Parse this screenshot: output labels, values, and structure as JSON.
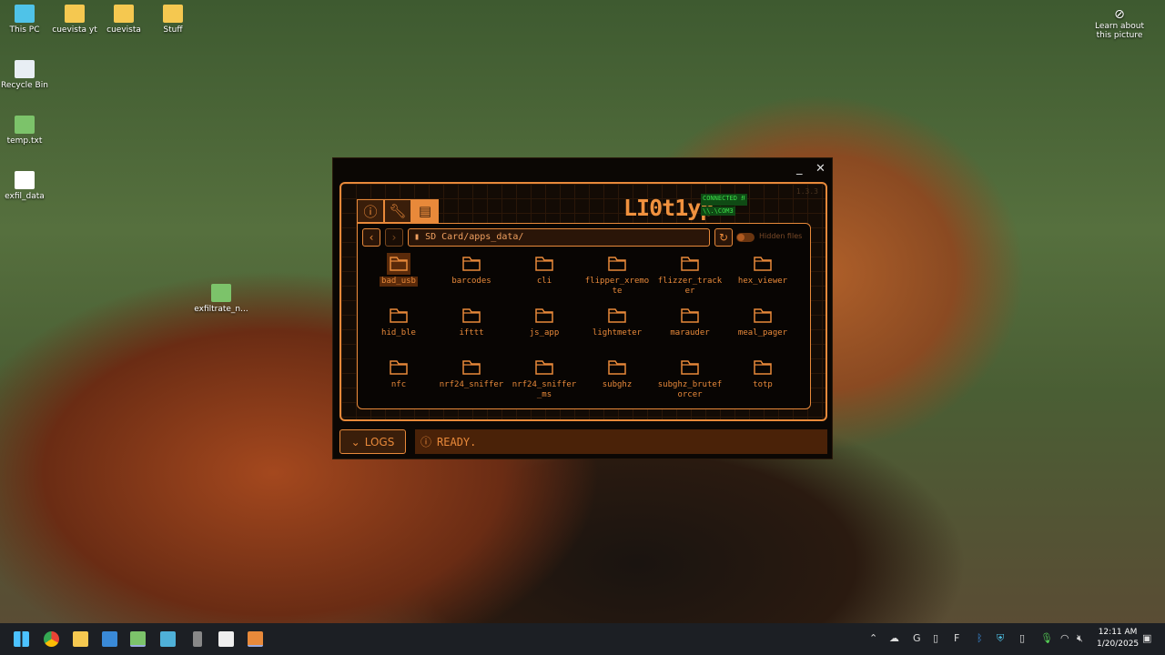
{
  "desktop": {
    "icons": [
      {
        "label": "This PC",
        "color": "#4fc3e8"
      },
      {
        "label": "cuevista yt",
        "color": "#f5c850"
      },
      {
        "label": "cuevista",
        "color": "#f5c850"
      },
      {
        "label": "Stuff",
        "color": "#f5c850"
      },
      {
        "label": "Recycle Bin",
        "color": "#e8eef4"
      },
      {
        "label": "temp.txt",
        "color": "#7cc36a"
      },
      {
        "label": "exfil_data",
        "color": "#ffffff"
      },
      {
        "label": "exfiltrate_n...",
        "color": "#7cc36a"
      }
    ],
    "learn_about": "Learn about this picture"
  },
  "app": {
    "version": "1.3.3",
    "logo": "LI0t1yp",
    "connected": "CONNECTED ⭿",
    "port": "\\\\.\\COM3",
    "path": "SD Card/apps_data/",
    "hidden_files_label": "Hidden files",
    "hidden_files_on": false,
    "items": [
      "bad_usb",
      "barcodes",
      "cli",
      "flipper_xremote",
      "flizzer_tracker",
      "hex_viewer",
      "hid_ble",
      "ifttt",
      "js_app",
      "lightmeter",
      "marauder",
      "meal_pager",
      "nfc",
      "nrf24_sniffer",
      "nrf24_sniffer_ms",
      "subghz",
      "subghz_bruteforcer",
      "totp"
    ],
    "selected": "bad_usb",
    "logs_label": "LOGS",
    "status": "READY.",
    "accent": "#e8893a"
  },
  "taskbar": {
    "time": "12:11 AM",
    "date": "1/20/2025"
  }
}
